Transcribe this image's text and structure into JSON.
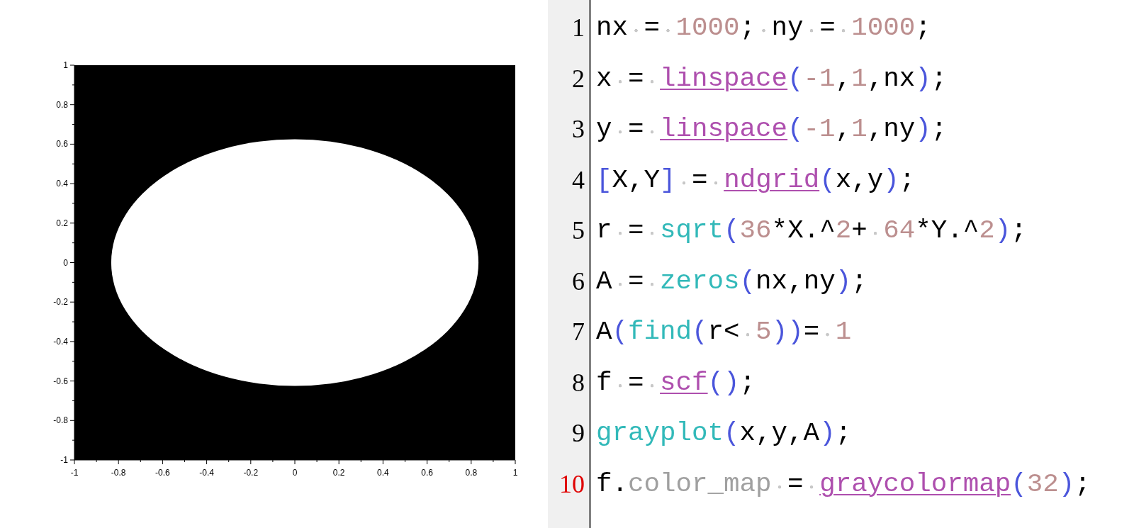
{
  "plot": {
    "x_ticks": [
      "-1",
      "-0.8",
      "-0.6",
      "-0.4",
      "-0.2",
      "0",
      "0.2",
      "0.4",
      "0.6",
      "0.8",
      "1"
    ],
    "y_ticks": [
      "1",
      "0.8",
      "0.6",
      "0.4",
      "0.2",
      "0",
      "-0.2",
      "-0.4",
      "-0.6",
      "-0.8",
      "-1"
    ]
  },
  "editor": {
    "lines": [
      {
        "number": "1",
        "current": false,
        "tokens": [
          {
            "kind": "var",
            "text": "nx"
          },
          {
            "kind": "space"
          },
          {
            "kind": "op",
            "text": "="
          },
          {
            "kind": "space"
          },
          {
            "kind": "num",
            "text": "1000"
          },
          {
            "kind": "op",
            "text": ";"
          },
          {
            "kind": "space"
          },
          {
            "kind": "var",
            "text": "ny"
          },
          {
            "kind": "space"
          },
          {
            "kind": "op",
            "text": "="
          },
          {
            "kind": "space"
          },
          {
            "kind": "num",
            "text": "1000"
          },
          {
            "kind": "op",
            "text": ";"
          }
        ]
      },
      {
        "number": "2",
        "current": false,
        "tokens": [
          {
            "kind": "var",
            "text": "x"
          },
          {
            "kind": "space"
          },
          {
            "kind": "op",
            "text": "="
          },
          {
            "kind": "space"
          },
          {
            "kind": "lib",
            "text": "linspace"
          },
          {
            "kind": "bracket",
            "text": "("
          },
          {
            "kind": "num",
            "text": "-1"
          },
          {
            "kind": "op",
            "text": ","
          },
          {
            "kind": "num",
            "text": "1"
          },
          {
            "kind": "op",
            "text": ","
          },
          {
            "kind": "var",
            "text": "nx"
          },
          {
            "kind": "bracket",
            "text": ")"
          },
          {
            "kind": "op",
            "text": ";"
          }
        ]
      },
      {
        "number": "3",
        "current": false,
        "tokens": [
          {
            "kind": "var",
            "text": "y"
          },
          {
            "kind": "space"
          },
          {
            "kind": "op",
            "text": "="
          },
          {
            "kind": "space"
          },
          {
            "kind": "lib",
            "text": "linspace"
          },
          {
            "kind": "bracket",
            "text": "("
          },
          {
            "kind": "num",
            "text": "-1"
          },
          {
            "kind": "op",
            "text": ","
          },
          {
            "kind": "num",
            "text": "1"
          },
          {
            "kind": "op",
            "text": ","
          },
          {
            "kind": "var",
            "text": "ny"
          },
          {
            "kind": "bracket",
            "text": ")"
          },
          {
            "kind": "op",
            "text": ";"
          }
        ]
      },
      {
        "number": "4",
        "current": false,
        "tokens": [
          {
            "kind": "bracket",
            "text": "["
          },
          {
            "kind": "var",
            "text": "X"
          },
          {
            "kind": "op",
            "text": ","
          },
          {
            "kind": "var",
            "text": "Y"
          },
          {
            "kind": "bracket",
            "text": "]"
          },
          {
            "kind": "space"
          },
          {
            "kind": "op",
            "text": "="
          },
          {
            "kind": "space"
          },
          {
            "kind": "lib",
            "text": "ndgrid"
          },
          {
            "kind": "bracket",
            "text": "("
          },
          {
            "kind": "var",
            "text": "x"
          },
          {
            "kind": "op",
            "text": ","
          },
          {
            "kind": "var",
            "text": "y"
          },
          {
            "kind": "bracket",
            "text": ")"
          },
          {
            "kind": "op",
            "text": ";"
          }
        ]
      },
      {
        "number": "5",
        "current": false,
        "tokens": [
          {
            "kind": "var",
            "text": "r"
          },
          {
            "kind": "space"
          },
          {
            "kind": "op",
            "text": "="
          },
          {
            "kind": "space"
          },
          {
            "kind": "builtin",
            "text": "sqrt"
          },
          {
            "kind": "bracket",
            "text": "("
          },
          {
            "kind": "num",
            "text": "36"
          },
          {
            "kind": "op",
            "text": "*"
          },
          {
            "kind": "var",
            "text": "X"
          },
          {
            "kind": "op",
            "text": ".^"
          },
          {
            "kind": "num",
            "text": "2"
          },
          {
            "kind": "op",
            "text": "+"
          },
          {
            "kind": "space"
          },
          {
            "kind": "num",
            "text": "64"
          },
          {
            "kind": "op",
            "text": "*"
          },
          {
            "kind": "var",
            "text": "Y"
          },
          {
            "kind": "op",
            "text": ".^"
          },
          {
            "kind": "num",
            "text": "2"
          },
          {
            "kind": "bracket",
            "text": ")"
          },
          {
            "kind": "op",
            "text": ";"
          }
        ]
      },
      {
        "number": "6",
        "current": false,
        "tokens": [
          {
            "kind": "var",
            "text": "A"
          },
          {
            "kind": "space"
          },
          {
            "kind": "op",
            "text": "="
          },
          {
            "kind": "space"
          },
          {
            "kind": "builtin",
            "text": "zeros"
          },
          {
            "kind": "bracket",
            "text": "("
          },
          {
            "kind": "var",
            "text": "nx"
          },
          {
            "kind": "op",
            "text": ","
          },
          {
            "kind": "var",
            "text": "ny"
          },
          {
            "kind": "bracket",
            "text": ")"
          },
          {
            "kind": "op",
            "text": ";"
          }
        ]
      },
      {
        "number": "7",
        "current": false,
        "tokens": [
          {
            "kind": "var",
            "text": "A"
          },
          {
            "kind": "bracket",
            "text": "("
          },
          {
            "kind": "builtin",
            "text": "find"
          },
          {
            "kind": "bracket",
            "text": "("
          },
          {
            "kind": "var",
            "text": "r"
          },
          {
            "kind": "op",
            "text": "<"
          },
          {
            "kind": "space"
          },
          {
            "kind": "num",
            "text": "5"
          },
          {
            "kind": "bracket",
            "text": "))"
          },
          {
            "kind": "op",
            "text": "="
          },
          {
            "kind": "space"
          },
          {
            "kind": "num",
            "text": "1"
          }
        ]
      },
      {
        "number": "8",
        "current": false,
        "tokens": [
          {
            "kind": "var",
            "text": "f"
          },
          {
            "kind": "space"
          },
          {
            "kind": "op",
            "text": "="
          },
          {
            "kind": "space"
          },
          {
            "kind": "lib",
            "text": "scf"
          },
          {
            "kind": "bracket",
            "text": "()"
          },
          {
            "kind": "op",
            "text": ";"
          }
        ]
      },
      {
        "number": "9",
        "current": false,
        "tokens": [
          {
            "kind": "builtin",
            "text": "grayplot"
          },
          {
            "kind": "bracket",
            "text": "("
          },
          {
            "kind": "var",
            "text": "x"
          },
          {
            "kind": "op",
            "text": ","
          },
          {
            "kind": "var",
            "text": "y"
          },
          {
            "kind": "op",
            "text": ","
          },
          {
            "kind": "var",
            "text": "A"
          },
          {
            "kind": "bracket",
            "text": ")"
          },
          {
            "kind": "op",
            "text": ";"
          }
        ]
      },
      {
        "number": "10",
        "current": true,
        "tokens": [
          {
            "kind": "var",
            "text": "f"
          },
          {
            "kind": "op",
            "text": "."
          },
          {
            "kind": "field",
            "text": "color_map"
          },
          {
            "kind": "space"
          },
          {
            "kind": "op",
            "text": "="
          },
          {
            "kind": "space"
          },
          {
            "kind": "lib",
            "text": "graycolormap"
          },
          {
            "kind": "bracket",
            "text": "("
          },
          {
            "kind": "num",
            "text": "32"
          },
          {
            "kind": "bracket",
            "text": ")"
          },
          {
            "kind": "op",
            "text": ";"
          }
        ]
      }
    ]
  }
}
